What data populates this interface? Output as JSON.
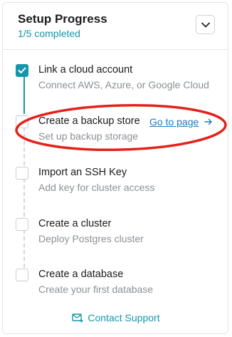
{
  "header": {
    "title": "Setup Progress",
    "progress_text": "1/5 completed",
    "toggle_icon": "chevron-down-icon"
  },
  "steps": [
    {
      "title": "Link a cloud account",
      "description": "Connect AWS, Azure, or Google Cloud",
      "completed": true
    },
    {
      "title": "Create a backup store",
      "description": "Set up backup storage",
      "completed": false,
      "link_label": "Go to page",
      "link_icon": "arrow-right-icon"
    },
    {
      "title": "Import an SSH Key",
      "description": "Add key for cluster access",
      "completed": false
    },
    {
      "title": "Create a cluster",
      "description": "Deploy Postgres cluster",
      "completed": false
    },
    {
      "title": "Create a database",
      "description": "Create your first database",
      "completed": false
    }
  ],
  "footer": {
    "support_label": "Contact Support",
    "support_icon": "mail-icon"
  },
  "colors": {
    "accent": "#1497aa",
    "link": "#1a7bbf",
    "annotation": "#e3221b"
  }
}
